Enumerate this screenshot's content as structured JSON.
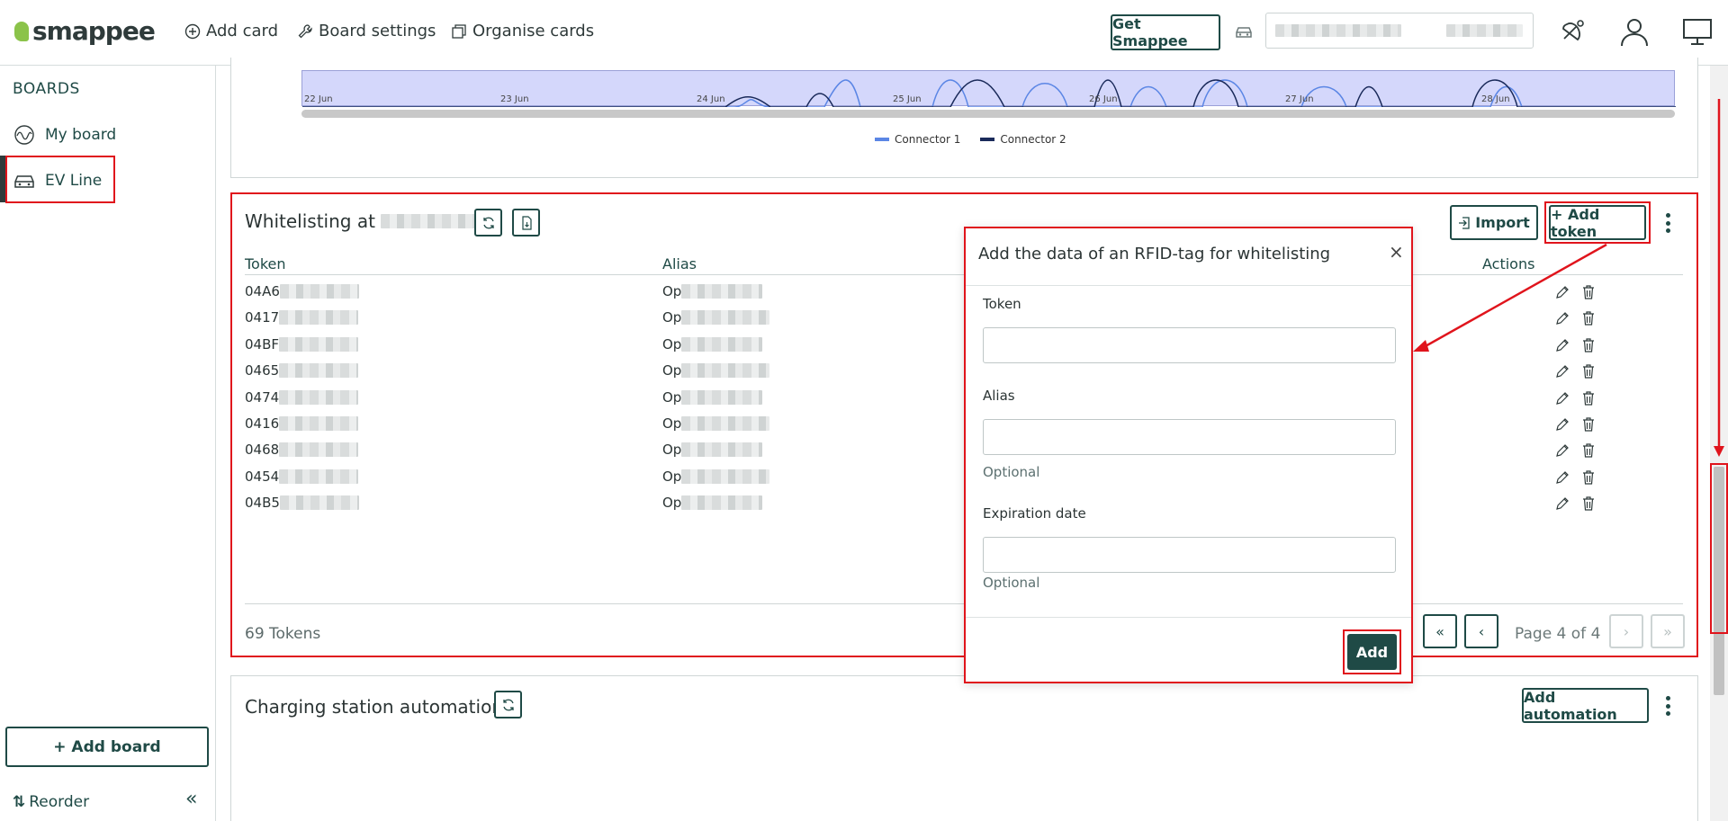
{
  "header": {
    "brand": "smappee",
    "add_card": "Add card",
    "board_settings": "Board settings",
    "organise_cards": "Organise cards",
    "get_smappee": "Get Smappee"
  },
  "sidebar": {
    "title": "BOARDS",
    "items": [
      {
        "label": "My board",
        "icon": "pulse-icon"
      },
      {
        "label": "EV Line",
        "icon": "car-icon"
      }
    ],
    "add_board": "+ Add board",
    "reorder": "Reorder"
  },
  "chart": {
    "dates": [
      "22 Jun",
      "23 Jun",
      "24 Jun",
      "25 Jun",
      "26 Jun",
      "27 Jun",
      "28 Jun"
    ],
    "legend": [
      "Connector 1",
      "Connector 2"
    ],
    "colors": {
      "connector1": "#5b86e5",
      "connector2": "#1a2a5a"
    }
  },
  "whitelist": {
    "title": "Whitelisting at",
    "import": "Import",
    "add_token": "+ Add token",
    "columns": {
      "token": "Token",
      "alias": "Alias",
      "actions": "Actions"
    },
    "rows": [
      {
        "token": "04A6",
        "alias": "Op"
      },
      {
        "token": "0417",
        "alias": "Op"
      },
      {
        "token": "04BF",
        "alias": "Op"
      },
      {
        "token": "0465",
        "alias": "Op"
      },
      {
        "token": "0474",
        "alias": "Op"
      },
      {
        "token": "0416",
        "alias": "Op"
      },
      {
        "token": "0468",
        "alias": "Op"
      },
      {
        "token": "0454",
        "alias": "Op"
      },
      {
        "token": "04B5",
        "alias": "Op"
      }
    ],
    "count": "69 Tokens",
    "pager": {
      "first": "«",
      "prev": "‹",
      "page": "Page 4 of 4",
      "next": "›",
      "last": "»"
    }
  },
  "automations": {
    "title": "Charging station automations",
    "add_automation": "Add automation"
  },
  "modal": {
    "title": "Add the data of an RFID-tag for whitelisting",
    "close": "×",
    "token_label": "Token",
    "alias_label": "Alias",
    "alias_hint": "Optional",
    "expiration_label": "Expiration date",
    "expiration_hint": "Optional",
    "add": "Add"
  }
}
